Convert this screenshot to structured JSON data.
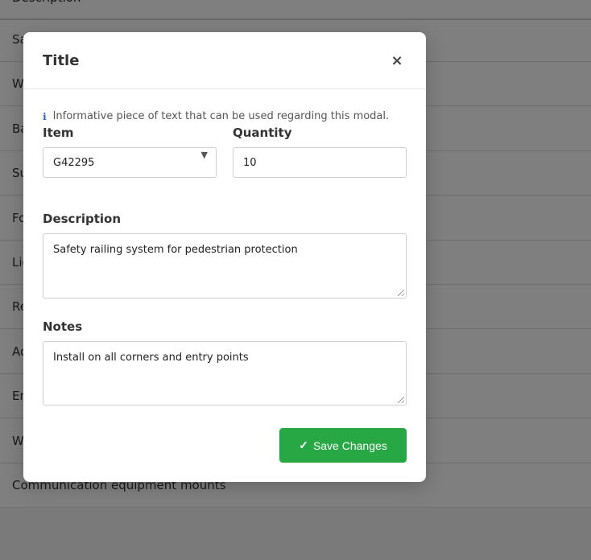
{
  "background_table": {
    "header": "Description",
    "rows": [
      "Sa",
      "W",
      "Ba",
      "Su",
      "Fo",
      "Lig",
      "Re",
      "Ac",
      "En",
      "W",
      "Communication equipment mounts"
    ]
  },
  "modal": {
    "title": "Title",
    "close_glyph": "×",
    "info_icon": "ℹ",
    "info_text": "Informative piece of text that can be used regarding this modal.",
    "item": {
      "label": "Item",
      "value": "G42295",
      "arrow": "▼"
    },
    "quantity": {
      "label": "Quantity",
      "value": "10"
    },
    "description": {
      "label": "Description",
      "value": "Safety railing system for pedestrian protection"
    },
    "notes": {
      "label": "Notes",
      "value": "Install on all corners and entry points"
    },
    "save_button": {
      "check": "✓",
      "label": "Save Changes"
    }
  },
  "colors": {
    "primary_green": "#28a745",
    "info_blue": "#2a62b8",
    "overlay": "rgba(0,0,0,0.5)"
  }
}
